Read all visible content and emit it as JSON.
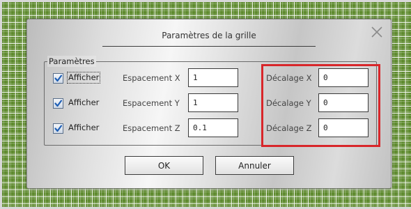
{
  "dialog": {
    "title": "Paramètres de la grille",
    "close_glyph": "×"
  },
  "group": {
    "legend": "Paramètres"
  },
  "rows": [
    {
      "checkbox_label": "Afficher",
      "checked": true,
      "spacing_label": "Espacement X",
      "spacing_value": "1",
      "offset_label": "Décalage X",
      "offset_value": "0"
    },
    {
      "checkbox_label": "Afficher",
      "checked": true,
      "spacing_label": "Espacement Y",
      "spacing_value": "1",
      "offset_label": "Décalage Y",
      "offset_value": "0"
    },
    {
      "checkbox_label": "Afficher",
      "checked": true,
      "spacing_label": "Espacement Z",
      "spacing_value": "0.1",
      "offset_label": "Décalage Z",
      "offset_value": "0"
    }
  ],
  "buttons": {
    "ok": "OK",
    "cancel": "Annuler"
  },
  "colors": {
    "grid_background": "#5e8a2e",
    "highlight": "#d8262a",
    "checkmark": "#1f5fb5"
  },
  "icons": {
    "close": "close-icon",
    "checkmark": "checkmark-icon"
  }
}
